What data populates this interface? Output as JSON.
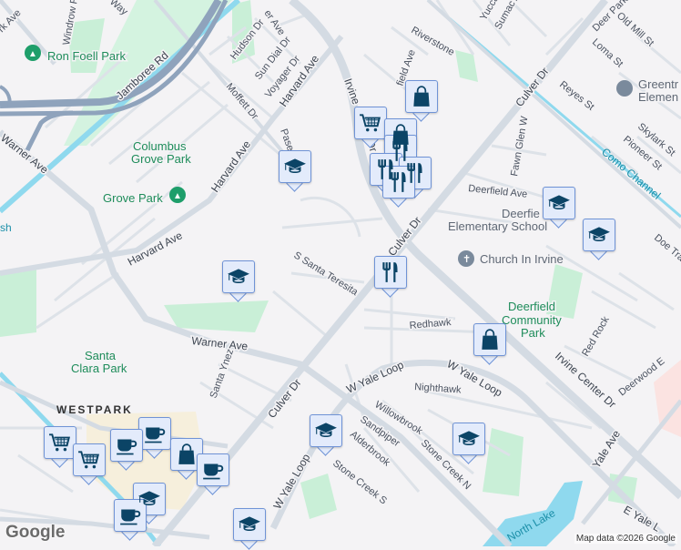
{
  "map": {
    "neighborhood": "WESTPARK",
    "roads": {
      "jamboree": "Jamboree Rd",
      "harvard1": "Harvard Ave",
      "harvard2": "Harvard Ave",
      "harvard3": "Harvard Ave",
      "warner1": "Warner Ave",
      "warner2": "Warner Ave",
      "irvine_center1": "Irvine Center Dr",
      "irvine_center2": "Irvine Center Dr",
      "culver1": "Culver Dr",
      "culver2": "Culver Dr",
      "culver3": "Culver Dr",
      "yale_loop1": "W Yale Loop",
      "yale_loop2": "W Yale Loop",
      "yale_loop3": "W Yale Loop",
      "e_yale": "E Yale L",
      "yale_ave": "Yale Ave",
      "deerfield": "Deerfield Ave",
      "riverstone": "Riverstone",
      "fawn_glen": "Fawn Glen W",
      "redhawk": "Redhawk",
      "nighthawk": "Nighthawk",
      "willowbrook": "Willowbrook",
      "sandpiper": "Sandpiper",
      "alderbrook": "Alderbrook",
      "stone_creek_n": "Stone Creek N",
      "stone_creek_s": "Stone Creek S",
      "santa_teresita": "S Santa Teresita",
      "santa_ynez": "Santa Ynez",
      "moffett": "Moffett Dr",
      "hudson": "Hudson Dr",
      "sun_dial": "Sun Dial Dr",
      "voyager": "Voyager Dr",
      "windrow": "Windrow R",
      "paseo": "Paseo",
      "reyes": "Reyes St",
      "loma": "Loma St",
      "old_mill": "Old Mill St",
      "deer_park": "Deer Park",
      "skylark": "Skylark St",
      "pioneer": "Pioneer St",
      "yucca": "Yucca",
      "sumac": "Sumac Av",
      "red_rock": "Red Rock",
      "deerwood": "Deerwood E",
      "doe_tr": "Doe Tra",
      "field_ave": "field Ave",
      "park_ave": "rk Ave",
      "ya_ave": "er Ave",
      "way": "Way"
    },
    "parks": {
      "ron_foell": "Ron Foell Park",
      "columbus_1": "Columbus",
      "columbus_2": "Grove Park",
      "grove": "Grove Park",
      "santa_clara_1": "Santa",
      "santa_clara_2": "Clara Park",
      "deerfield_1": "Deerfield",
      "deerfield_2": "Community",
      "deerfield_3": "Park"
    },
    "pois": {
      "church": "Church In Irvine",
      "deerfield_school_1": "Deerfie",
      "deerfield_school_2": "Elementary School",
      "greentree_1": "Greentr",
      "greentree_2": "Elemen"
    },
    "water": {
      "como": "Como Channel",
      "north_lake": "North Lake",
      "marsh": "sh"
    },
    "attribution": "Map data ©2026 Google",
    "logo": "Google"
  },
  "markers": [
    {
      "type": "school"
    },
    {
      "type": "school"
    },
    {
      "type": "shopping"
    },
    {
      "type": "grocery"
    },
    {
      "type": "shopping"
    },
    {
      "type": "restaurant"
    },
    {
      "type": "restaurant"
    },
    {
      "type": "restaurant"
    },
    {
      "type": "restaurant"
    },
    {
      "type": "school"
    },
    {
      "type": "school"
    },
    {
      "type": "restaurant"
    },
    {
      "type": "shopping"
    },
    {
      "type": "school"
    },
    {
      "type": "school"
    },
    {
      "type": "grocery"
    },
    {
      "type": "grocery"
    },
    {
      "type": "cafe"
    },
    {
      "type": "cafe"
    },
    {
      "type": "shopping"
    },
    {
      "type": "cafe"
    },
    {
      "type": "school"
    },
    {
      "type": "cafe"
    },
    {
      "type": "school"
    }
  ],
  "colors": {
    "marker_icon": "#0b4466",
    "marker_bg": "#e3ebfb",
    "park": "#c9efd7",
    "water": "#8fd9ee",
    "road": "#d4dbe3"
  }
}
